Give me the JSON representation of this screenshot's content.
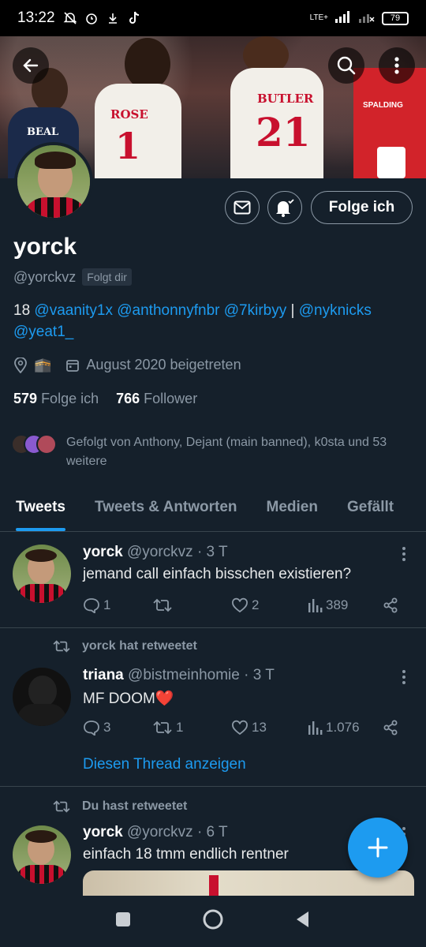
{
  "status": {
    "time": "13:22",
    "network": "LTE+",
    "battery": "79"
  },
  "header": {
    "back_icon": "arrow-left-icon",
    "search_icon": "search-icon",
    "more_icon": "more-vertical-icon"
  },
  "banner": {
    "jersey1_name": "ROSE",
    "jersey1_number": "1",
    "jersey2_name": "BUTLER",
    "jersey2_number": "21",
    "jersey3_name": "BEAL",
    "hoop_brand": "SPALDING"
  },
  "profile": {
    "name": "yorck",
    "handle": "@yorckvz",
    "follows_you": "Folgt dir",
    "follow_button": "Folge ich",
    "bio_prefix": "18 ",
    "bio_mentions": [
      "@vaanity1x",
      "@anthonnyfnbr",
      "@7kirbyy"
    ],
    "bio_separator": " | ",
    "bio_mentions2": [
      "@nyknicks",
      "@yeat1_"
    ],
    "location_emoji": "🕋",
    "joined": "August 2020 beigetreten",
    "following_count": "579",
    "following_label": "Folge ich",
    "followers_count": "766",
    "followers_label": "Follower",
    "followed_by": "Gefolgt von Anthony, Dejant (main banned), k0sta und 53 weitere"
  },
  "tabs": [
    {
      "label": "Tweets",
      "active": true
    },
    {
      "label": "Tweets & Antworten",
      "active": false
    },
    {
      "label": "Medien",
      "active": false
    },
    {
      "label": "Gefällt",
      "active": false
    }
  ],
  "tweets": [
    {
      "name": "yorck",
      "handle": "@yorckvz · 3 T",
      "text": "jemand call einfach bisschen existieren?",
      "replies": "1",
      "retweets": "",
      "likes": "2",
      "views": "389"
    },
    {
      "retweet_banner": "yorck hat retweetet",
      "name": "triana",
      "handle": "@bistmeinhomie · 3 T",
      "text": "MF DOOM❤️",
      "replies": "3",
      "retweets": "1",
      "likes": "13",
      "views": "1.076",
      "thread_link": "Diesen Thread anzeigen"
    },
    {
      "retweet_banner": "Du hast retweetet",
      "name": "yorck",
      "handle": "@yorckvz · 6 T",
      "text": "einfach 18 tmm endlich rentner"
    }
  ],
  "colors": {
    "background": "#15202b",
    "accent": "#1d9bf0",
    "muted": "#8b98a5",
    "border": "#38444d"
  }
}
